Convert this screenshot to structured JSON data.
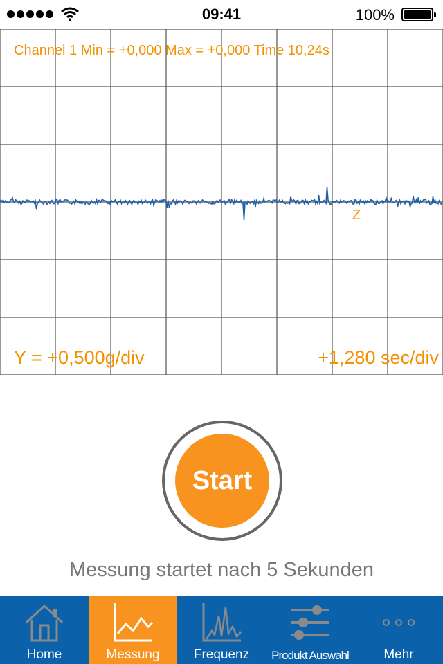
{
  "status_bar": {
    "time": "09:41",
    "battery": "100%"
  },
  "scope": {
    "channel_info": "Channel 1 Min = +0,000 Max = +0,000 Time 10,24s",
    "trigger_marker": "Z",
    "y_scale": "Y = +0,500g/div",
    "x_scale": "+1,280 sec/div",
    "colors": {
      "grid": "#555555",
      "trace": "#1f5fa8",
      "text": "#f39200"
    }
  },
  "start_button": {
    "label": "Start",
    "color": "#f7931e"
  },
  "status_message": "Messung startet nach 5 Sekunden",
  "tab_bar": {
    "background": "#0b62ab",
    "active_color": "#f7931e",
    "tabs": [
      {
        "label": "Home",
        "icon": "home-icon",
        "active": false
      },
      {
        "label": "Messung",
        "icon": "line-chart-icon",
        "active": true
      },
      {
        "label": "Frequenz",
        "icon": "spectrum-chart-icon",
        "active": false
      },
      {
        "label": "Produkt Auswahl",
        "icon": "sliders-icon",
        "active": false
      },
      {
        "label": "Mehr",
        "icon": "more-dots-icon",
        "active": false
      }
    ]
  }
}
